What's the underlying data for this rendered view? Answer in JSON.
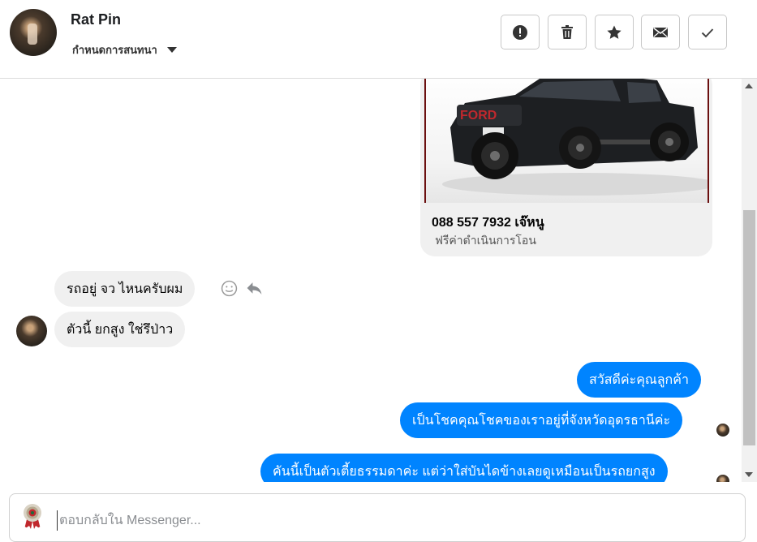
{
  "header": {
    "name": "Rat Pin",
    "subtitle": "กำหนดการสนทนา",
    "actions": [
      {
        "id": "spam",
        "icon": "exclamation-icon"
      },
      {
        "id": "delete",
        "icon": "trash-icon"
      },
      {
        "id": "star",
        "icon": "star-icon"
      },
      {
        "id": "mail",
        "icon": "envelope-icon"
      },
      {
        "id": "done",
        "icon": "check-icon"
      }
    ]
  },
  "thread": {
    "card": {
      "title": "088 557 7932 เจ๊หนู",
      "subtitle": "ฟรีค่าดำเนินการโอน",
      "image": "black-ford-pickup-truck"
    },
    "incoming": [
      {
        "text": "รถอยู่ จว ไหนครับผม"
      },
      {
        "text": "ตัวนี้ ยกสูง ใช่รึป่าว"
      }
    ],
    "outgoing": [
      {
        "text": "สวัสดีค่ะคุณลูกค้า"
      },
      {
        "text": "เป็นโชคคุณโชคของเราอยู่ที่จังหวัดอุดรธานีค่ะ"
      },
      {
        "text": "คันนี้เป็นตัวเตี้ยธรรมดาค่ะ แต่ว่าใส่บันไดข้างเลยดูเหมือนเป็นรถยกสูง"
      }
    ]
  },
  "composer": {
    "placeholder": "ตอบกลับใน Messenger..."
  },
  "colors": {
    "outgoing_bubble": "#0084ff",
    "incoming_bubble": "#f0f0f0"
  }
}
